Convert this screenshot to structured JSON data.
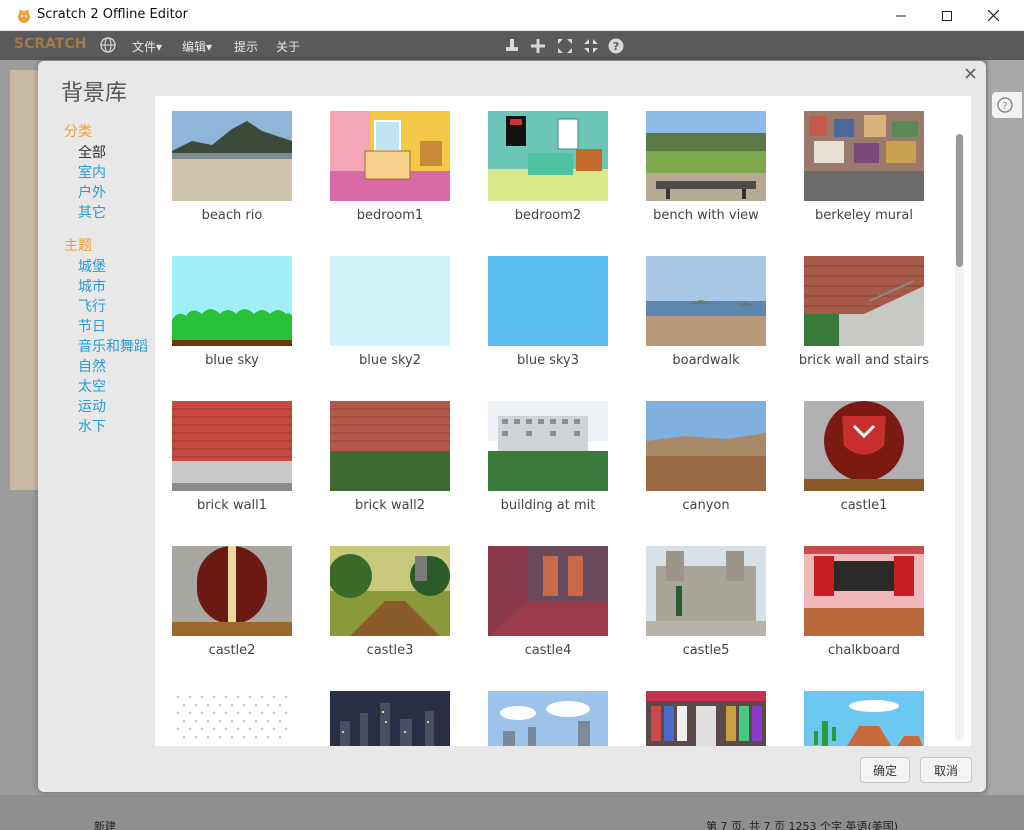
{
  "window": {
    "title": "Scratch 2 Offline Editor",
    "controls": [
      "minimize",
      "maximize",
      "close"
    ]
  },
  "menubar": {
    "logo": "SCRATCH",
    "menus": [
      "文件▾",
      "编辑▾",
      "提示",
      "关于"
    ]
  },
  "background": {
    "new_backdrop_label": "新建",
    "bottom_left": "新建",
    "bottom_status": "第 7 页, 共 7 页    1253 个字    英语(美国)"
  },
  "dialog": {
    "title": "背景库",
    "ok_label": "确定",
    "cancel_label": "取消",
    "categories_heading": "分类",
    "categories": [
      "全部",
      "室内",
      "户外",
      "其它"
    ],
    "active_category": "全部",
    "themes_heading": "主题",
    "themes": [
      "城堡",
      "城市",
      "飞行",
      "节日",
      "音乐和舞蹈",
      "自然",
      "太空",
      "运动",
      "水下"
    ],
    "backdrops": [
      {
        "label": "beach rio",
        "thumb": "beach"
      },
      {
        "label": "bedroom1",
        "thumb": "bedroom1"
      },
      {
        "label": "bedroom2",
        "thumb": "bedroom2"
      },
      {
        "label": "bench with view",
        "thumb": "bench"
      },
      {
        "label": "berkeley mural",
        "thumb": "mural"
      },
      {
        "label": "blue sky",
        "thumb": "bluesky"
      },
      {
        "label": "blue sky2",
        "thumb": "bluesky2"
      },
      {
        "label": "blue sky3",
        "thumb": "bluesky3"
      },
      {
        "label": "boardwalk",
        "thumb": "boardwalk"
      },
      {
        "label": "brick wall and stairs",
        "thumb": "brickstairs"
      },
      {
        "label": "brick wall1",
        "thumb": "brick1"
      },
      {
        "label": "brick wall2",
        "thumb": "brick2"
      },
      {
        "label": "building at mit",
        "thumb": "mit"
      },
      {
        "label": "canyon",
        "thumb": "canyon"
      },
      {
        "label": "castle1",
        "thumb": "castle1"
      },
      {
        "label": "castle2",
        "thumb": "castle2"
      },
      {
        "label": "castle3",
        "thumb": "castle3"
      },
      {
        "label": "castle4",
        "thumb": "castle4"
      },
      {
        "label": "castle5",
        "thumb": "castle5"
      },
      {
        "label": "chalkboard",
        "thumb": "chalkboard"
      },
      {
        "label": "",
        "thumb": "pattern"
      },
      {
        "label": "",
        "thumb": "citynight"
      },
      {
        "label": "",
        "thumb": "cityday"
      },
      {
        "label": "",
        "thumb": "clothing"
      },
      {
        "label": "",
        "thumb": "desert"
      }
    ]
  }
}
